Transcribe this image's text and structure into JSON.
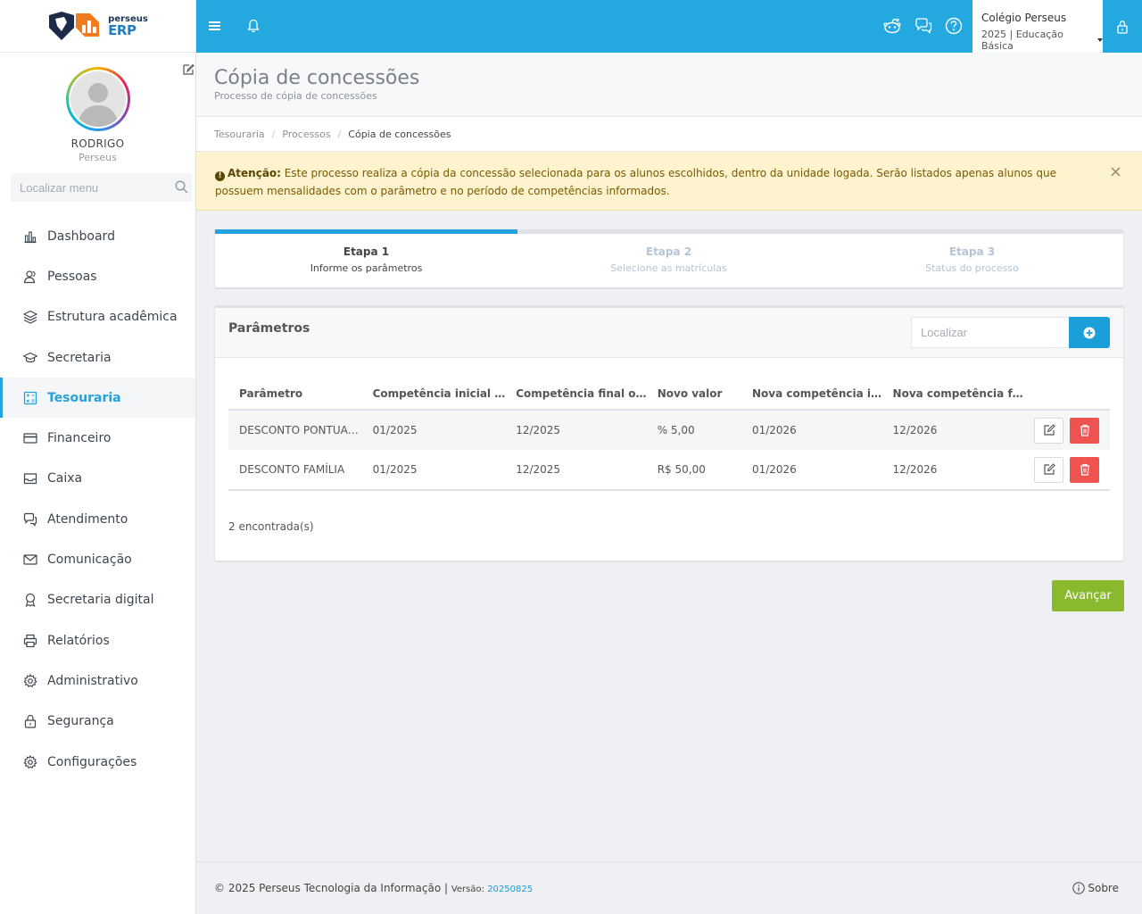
{
  "app": {
    "logo_small": "perseus",
    "logo_big": "ERP"
  },
  "user": {
    "name": "RODRIGO",
    "org": "Perseus"
  },
  "menu_search": {
    "placeholder": "Localizar menu"
  },
  "menu": [
    {
      "label": "Dashboard",
      "icon": "chart-icon",
      "active": false
    },
    {
      "label": "Pessoas",
      "icon": "users-icon",
      "active": false
    },
    {
      "label": "Estrutura acadêmica",
      "icon": "layers-icon",
      "active": false
    },
    {
      "label": "Secretaria",
      "icon": "graduation-cap-icon",
      "active": false
    },
    {
      "label": "Tesouraria",
      "icon": "calculator-icon",
      "active": true
    },
    {
      "label": "Financeiro",
      "icon": "credit-card-icon",
      "active": false
    },
    {
      "label": "Caixa",
      "icon": "inbox-icon",
      "active": false
    },
    {
      "label": "Atendimento",
      "icon": "chat-icon",
      "active": false
    },
    {
      "label": "Comunicação",
      "icon": "envelope-icon",
      "active": false
    },
    {
      "label": "Secretaria digital",
      "icon": "award-icon",
      "active": false
    },
    {
      "label": "Relatórios",
      "icon": "printer-icon",
      "active": false
    },
    {
      "label": "Administrativo",
      "icon": "gear-icon",
      "active": false
    },
    {
      "label": "Segurança",
      "icon": "lock-icon",
      "active": false
    },
    {
      "label": "Configurações",
      "icon": "cog-icon",
      "active": false
    }
  ],
  "topbar": {
    "school_name": "Colégio Perseus",
    "school_period": "2025 | Educação Básica"
  },
  "page": {
    "title": "Cópia de concessões",
    "subtitle": "Processo de cópia de concessões"
  },
  "breadcrumb": [
    "Tesouraria",
    "Processos",
    "Cópia de concessões"
  ],
  "alert": {
    "label": "Atenção:",
    "text": " Este processo realiza a cópia da concessão selecionada para os alunos escolhidos, dentro da unidade logada. Serão listados apenas alunos que possuem mensalidades com o parâmetro e no período de competências informados.",
    "close": "×"
  },
  "steps": [
    {
      "title": "Etapa 1",
      "subtitle": "Informe os parâmetros",
      "active": true
    },
    {
      "title": "Etapa 2",
      "subtitle": "Selecione as matrículas",
      "active": false
    },
    {
      "title": "Etapa 3",
      "subtitle": "Status do processo",
      "active": false
    }
  ],
  "step_progress": 0.333,
  "params": {
    "title": "Parâmetros",
    "search_placeholder": "Localizar",
    "columns": [
      "Parâmetro",
      "Competência inicial …",
      "Competência final o…",
      "Novo valor",
      "Nova competência i…",
      "Nova competência f…"
    ],
    "rows": [
      [
        "DESCONTO PONTUA…",
        "01/2025",
        "12/2025",
        "% 5,00",
        "01/2026",
        "12/2026"
      ],
      [
        "DESCONTO FAMÍLIA",
        "01/2025",
        "12/2025",
        "R$ 50,00",
        "01/2026",
        "12/2026"
      ]
    ],
    "count": "2 encontrada(s)"
  },
  "next_button": "Avançar",
  "footer": {
    "copyright": "© 2025 Perseus Tecnologia da Informação | ",
    "version_label": "Versão: ",
    "version": "20250825",
    "about": "Sobre"
  },
  "colors": {
    "primary": "#23a8e0",
    "success": "#8ab92d",
    "danger": "#ef5350",
    "warning_bg": "#fdf3cf"
  }
}
